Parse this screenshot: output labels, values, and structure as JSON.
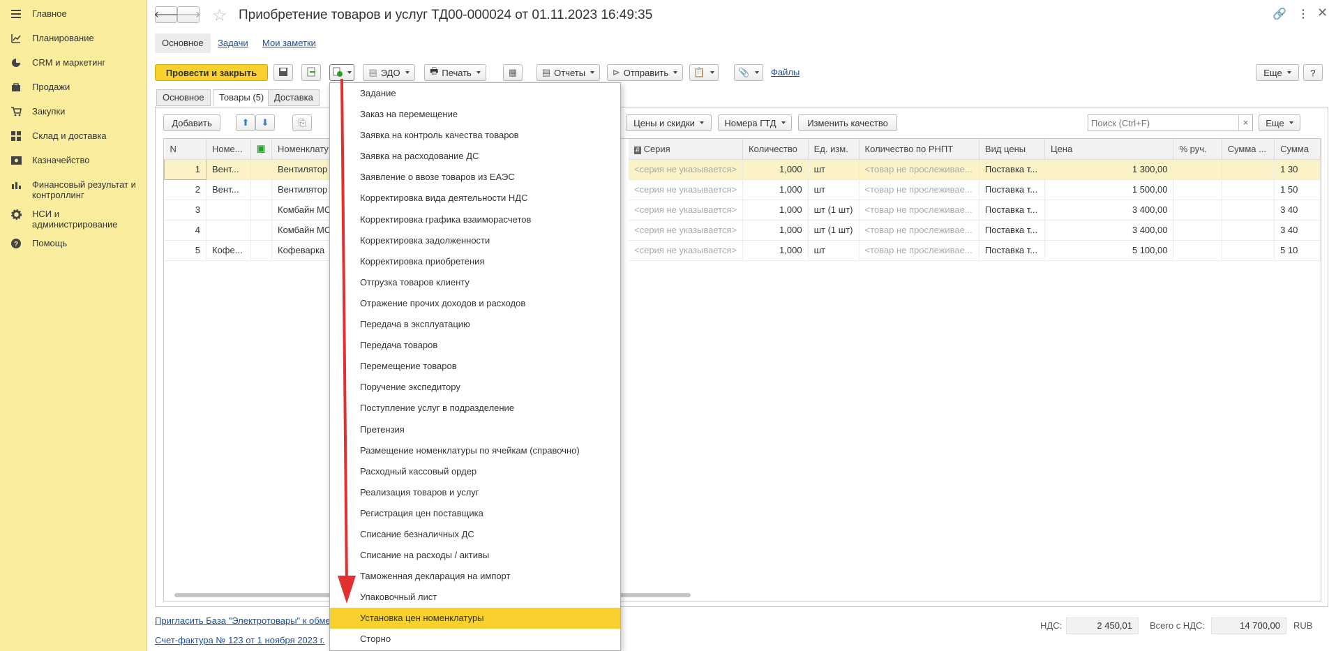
{
  "sidebar": {
    "items": [
      {
        "icon": "menu-icon",
        "label": "Главное"
      },
      {
        "icon": "planning-icon",
        "label": "Планирование"
      },
      {
        "icon": "crm-icon",
        "label": "CRM и маркетинг"
      },
      {
        "icon": "sales-icon",
        "label": "Продажи"
      },
      {
        "icon": "cart-icon",
        "label": "Закупки"
      },
      {
        "icon": "warehouse-icon",
        "label": "Склад и доставка"
      },
      {
        "icon": "treasury-icon",
        "label": "Казначейство"
      },
      {
        "icon": "finance-chart-icon",
        "label": "Финансовый результат и контроллинг"
      },
      {
        "icon": "gear-icon",
        "label": "НСИ и администрирование"
      },
      {
        "icon": "help-icon",
        "label": "Помощь"
      }
    ]
  },
  "header": {
    "title": "Приобретение товаров и услуг ТД00-000024 от 01.11.2023 16:49:35",
    "nav_tabs": {
      "main": "Основное",
      "tasks": "Задачи",
      "notes": "Мои заметки"
    }
  },
  "toolbar": {
    "post_close": "Провести и закрыть",
    "edo": "ЭДО",
    "print": "Печать",
    "reports": "Отчеты",
    "send": "Отправить",
    "files": "Файлы",
    "more": "Еще"
  },
  "doc_tabs": {
    "main": "Основное",
    "goods": "Товары (5)",
    "delivery": "Доставка"
  },
  "table_toolbar": {
    "add": "Добавить",
    "prices_discounts": "Цены и скидки",
    "gtd_numbers": "Номера ГТД",
    "change_quality": "Изменить качество",
    "search_placeholder": "Поиск (Ctrl+F)",
    "more": "Еще"
  },
  "table": {
    "left_headers": [
      "N",
      "Номе...",
      "",
      "Номенклату"
    ],
    "right_headers": [
      "Серия",
      "Количество",
      "Ед. изм.",
      "Количество по РНПТ",
      "Вид цены",
      "Цена",
      "% руч.",
      "Сумма ...",
      "Сумма"
    ],
    "rows": [
      {
        "n": "1",
        "code": "Вент...",
        "nom": "Вентилятор",
        "series": "<серия не указывается>",
        "qty": "1,000",
        "unit": "шт",
        "rnpt": "<товар не прослеживае...",
        "price_type": "Поставка т...",
        "price": "1 300,00",
        "sum": "1 30"
      },
      {
        "n": "2",
        "code": "Вент...",
        "nom": "Вентилятор",
        "series": "<серия не указывается>",
        "qty": "1,000",
        "unit": "шт",
        "rnpt": "<товар не прослеживае...",
        "price_type": "Поставка т...",
        "price": "1 500,00",
        "sum": "1 50"
      },
      {
        "n": "3",
        "code": "",
        "nom": "Комбайн МС",
        "series": "<серия не указывается>",
        "qty": "1,000",
        "unit": "шт (1 шт)",
        "rnpt": "<товар не прослеживае...",
        "price_type": "Поставка т...",
        "price": "3 400,00",
        "sum": "3 40"
      },
      {
        "n": "4",
        "code": "",
        "nom": "Комбайн МС",
        "series": "<серия не указывается>",
        "qty": "1,000",
        "unit": "шт (1 шт)",
        "rnpt": "<товар не прослеживае...",
        "price_type": "Поставка т...",
        "price": "3 400,00",
        "sum": "3 40"
      },
      {
        "n": "5",
        "code": "Кофе...",
        "nom": "Кофеварка",
        "series": "<серия не указывается>",
        "qty": "1,000",
        "unit": "шт",
        "rnpt": "<товар не прослеживае...",
        "price_type": "Поставка т...",
        "price": "5 100,00",
        "sum": "5 10"
      }
    ]
  },
  "menu": {
    "items": [
      "Задание",
      "Заказ на перемещение",
      "Заявка на контроль качества товаров",
      "Заявка на расходование ДС",
      "Заявление о ввозе товаров из ЕАЭС",
      "Корректировка вида деятельности НДС",
      "Корректировка графика взаиморасчетов",
      "Корректировка задолженности",
      "Корректировка приобретения",
      "Отгрузка товаров клиенту",
      "Отражение прочих доходов и расходов",
      "Передача в эксплуатацию",
      "Передача товаров",
      "Перемещение товаров",
      "Поручение экспедитору",
      "Поступление услуг в подразделение",
      "Претензия",
      "Размещение номенклатуры по ячейкам (справочно)",
      "Расходный кассовый ордер",
      "Реализация товаров и услуг",
      "Регистрация цен поставщика",
      "Списание безналичных ДС",
      "Списание на расходы / активы",
      "Таможенная декларация на импорт",
      "Упаковочный лист",
      "Установка цен номенклатуры",
      "Сторно"
    ],
    "highlighted_index": 25
  },
  "footer": {
    "invite_link": "Пригласить База \"Электротовары\" к обме",
    "invoice_link": "Счет-фактура № 123 от 1 ноября 2023 г.",
    "vat_label": "НДС:",
    "vat_value": "2 450,01",
    "total_label": "Всего с НДС:",
    "total_value": "14 700,00",
    "currency": "RUB"
  },
  "colors": {
    "sidebar_bg": "#fbed9e",
    "primary_button": "#f9d12e",
    "highlight": "#f9d12e",
    "arrow": "#e03030",
    "link": "#1a4fa0"
  }
}
